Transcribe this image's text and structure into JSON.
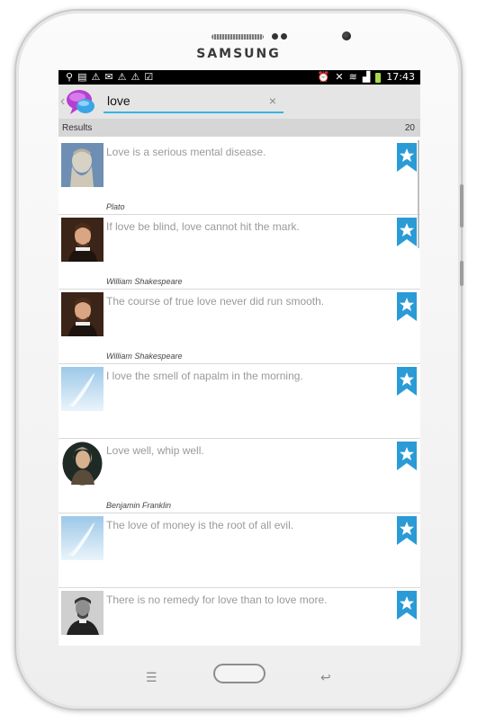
{
  "device": {
    "brand": "SAMSUNG"
  },
  "status_bar": {
    "left_icons": [
      "usb-icon",
      "sim-icon",
      "warning-icon",
      "mail-icon",
      "warning-icon",
      "warning-icon",
      "clipboard-icon"
    ],
    "right_icons": [
      "alarm-icon",
      "mute-icon",
      "wifi-icon",
      "signal-icon",
      "battery-icon"
    ],
    "time": "17:43"
  },
  "search": {
    "query": "love",
    "clear_label": "×"
  },
  "results": {
    "label": "Results",
    "count": "20"
  },
  "quotes": [
    {
      "text": "Love is a serious mental disease.",
      "author": "Plato",
      "image": "plato-bust"
    },
    {
      "text": "If love be blind, love cannot hit the mark.",
      "author": "William Shakespeare",
      "image": "shakespeare-portrait"
    },
    {
      "text": "The course of true love never did run smooth.",
      "author": "William Shakespeare",
      "image": "shakespeare-portrait"
    },
    {
      "text": "I love the smell of napalm in the morning.",
      "author": "",
      "image": "quill-placeholder"
    },
    {
      "text": "Love well, whip well.",
      "author": "Benjamin Franklin",
      "image": "franklin-portrait"
    },
    {
      "text": "The love of money is the root of all evil.",
      "author": "",
      "image": "quill-placeholder"
    },
    {
      "text": "There is no remedy for love than to love more.",
      "author": "",
      "image": "thoreau-portrait"
    }
  ],
  "colors": {
    "accent": "#33b5e5",
    "bookmark": "#2a9bd5",
    "actionbar": "#e5e5e5"
  }
}
